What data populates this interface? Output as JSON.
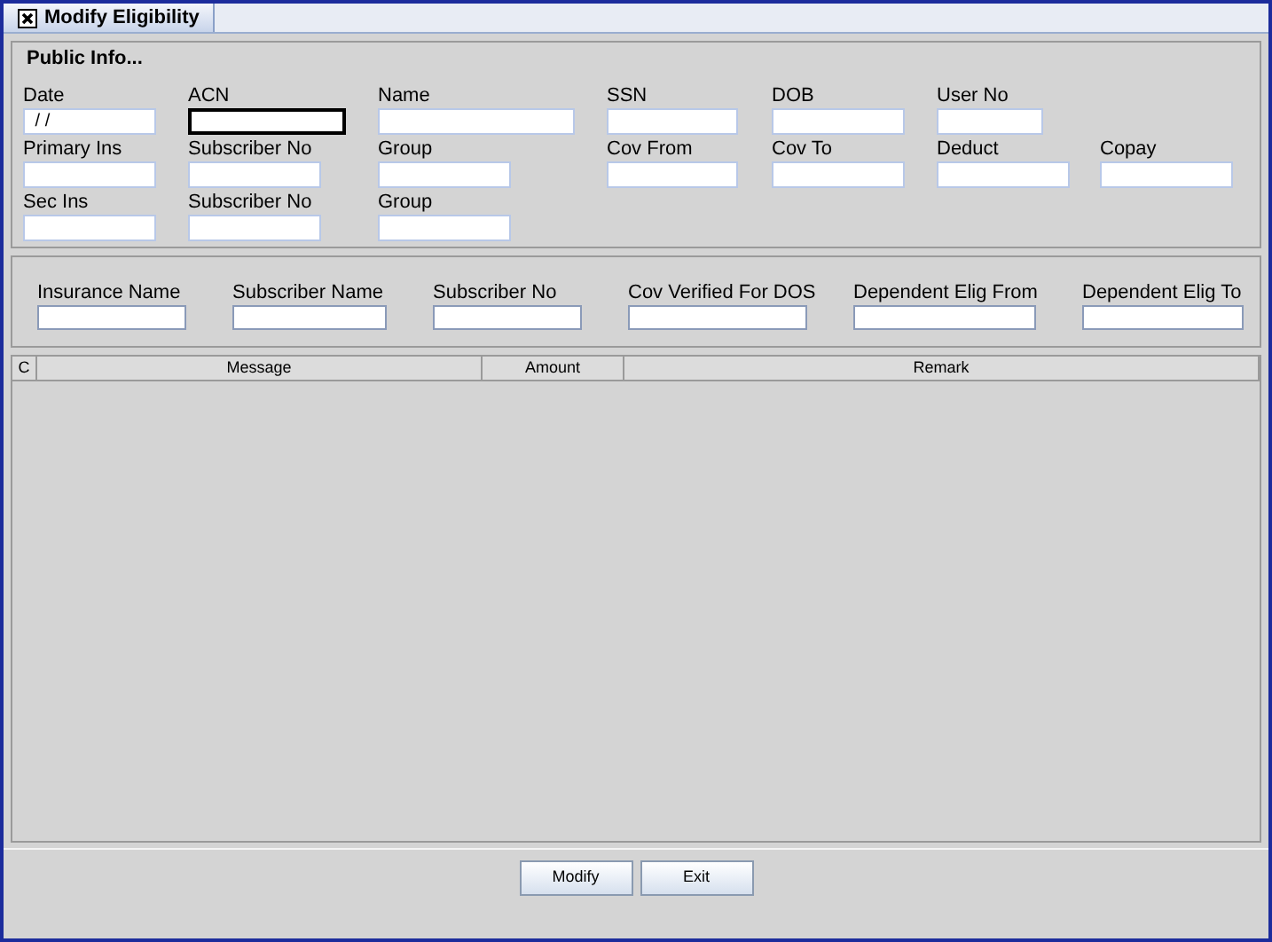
{
  "tab": {
    "title": "Modify Eligibility",
    "selected": true
  },
  "public_info": {
    "title": "Public Info...",
    "rows": [
      [
        {
          "label": "Date",
          "value": " / /",
          "focused": false
        },
        {
          "label": "ACN",
          "focused": true
        },
        {
          "label": "Name",
          "focused": false
        },
        {
          "label": "SSN",
          "focused": false
        },
        {
          "label": "DOB",
          "focused": false
        },
        {
          "label": "User No",
          "focused": false
        }
      ],
      [
        {
          "label": "Primary Ins",
          "focused": false
        },
        {
          "label": "Subscriber No",
          "focused": false
        },
        {
          "label": "Group",
          "focused": false
        },
        {
          "label": "Cov From",
          "focused": false
        },
        {
          "label": "Cov To",
          "focused": false
        },
        {
          "label": "Deduct",
          "focused": false
        },
        {
          "label": "Copay",
          "focused": false
        }
      ],
      [
        {
          "label": "Sec Ins",
          "focused": false
        },
        {
          "label": "Subscriber No",
          "focused": false
        },
        {
          "label": "Group",
          "focused": false
        }
      ]
    ]
  },
  "coverage": [
    {
      "label": "Insurance Name"
    },
    {
      "label": "Subscriber Name"
    },
    {
      "label": "Subscriber No"
    },
    {
      "label": "Cov Verified For DOS"
    },
    {
      "label": "Dependent Elig From"
    },
    {
      "label": "Dependent Elig To"
    }
  ],
  "table": {
    "columns": [
      "C",
      "Message",
      "Amount",
      "Remark"
    ]
  },
  "buttons": [
    "Modify",
    "Exit"
  ]
}
